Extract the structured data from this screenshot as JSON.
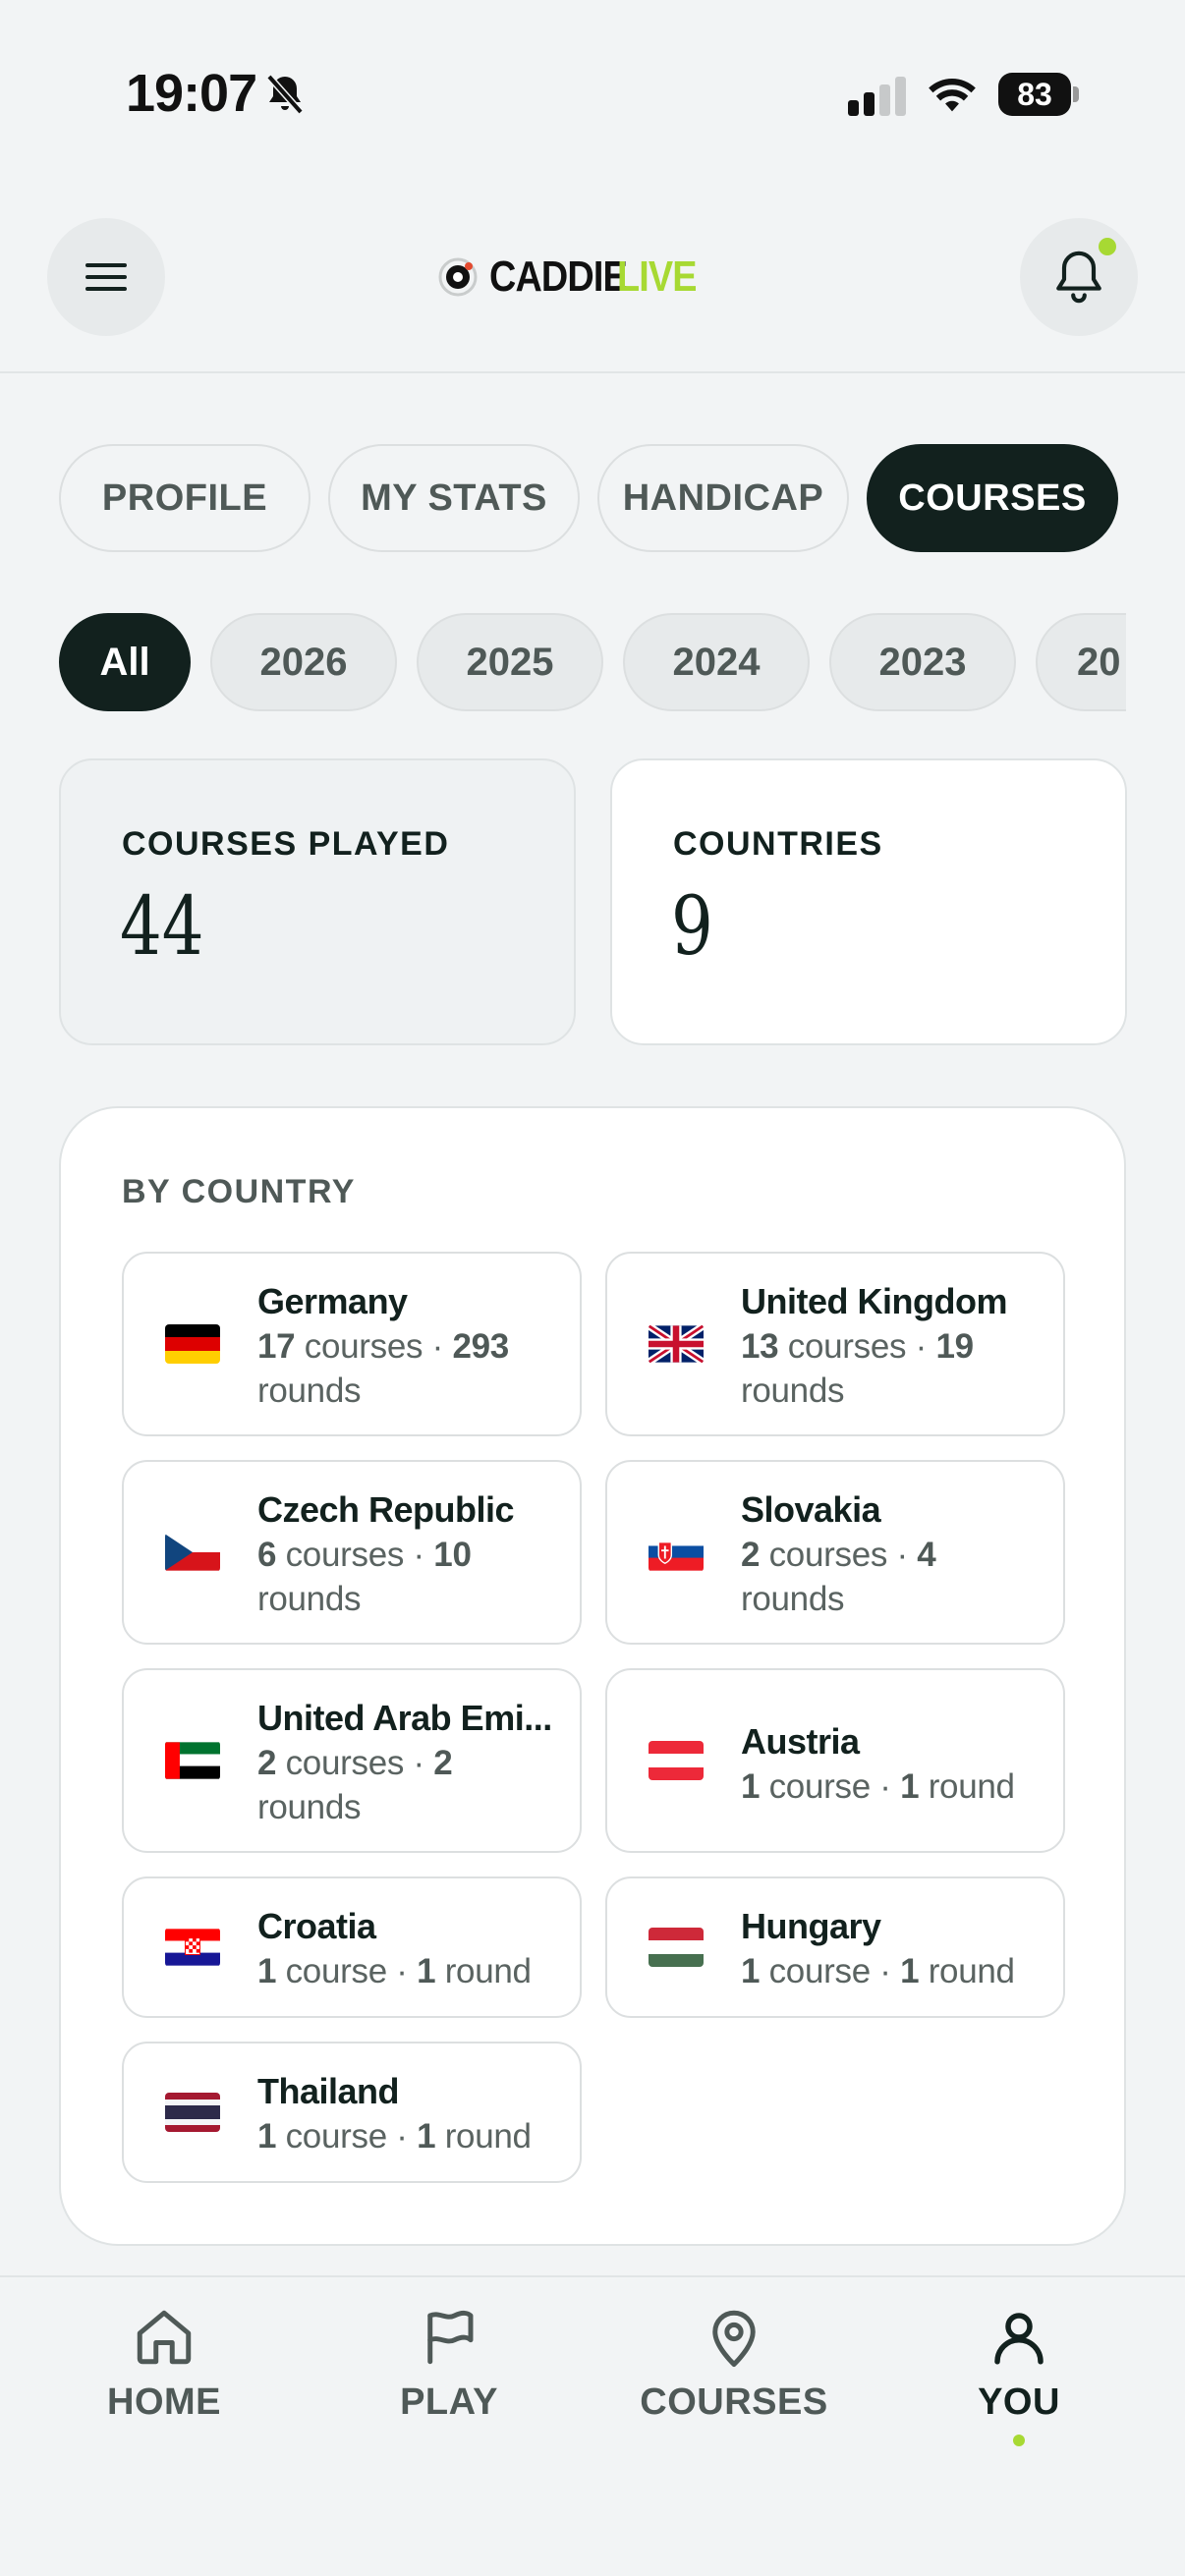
{
  "status_bar": {
    "time": "19:07",
    "battery": "83"
  },
  "header": {
    "logo_word1": "CADDIE",
    "logo_word2": "LIVE",
    "menu_icon": "hamburger-menu-icon",
    "bell_icon": "bell-icon"
  },
  "tabs": [
    {
      "label": "PROFILE",
      "active": false
    },
    {
      "label": "MY STATS",
      "active": false
    },
    {
      "label": "HANDICAP",
      "active": false
    },
    {
      "label": "COURSES",
      "active": true
    }
  ],
  "years": [
    {
      "label": "All",
      "active": true
    },
    {
      "label": "2026",
      "active": false
    },
    {
      "label": "2025",
      "active": false
    },
    {
      "label": "2024",
      "active": false
    },
    {
      "label": "2023",
      "active": false
    },
    {
      "label": "20",
      "active": false
    }
  ],
  "stats": {
    "courses_played_label": "COURSES PLAYED",
    "courses_played_value": "44",
    "countries_label": "COUNTRIES",
    "countries_value": "9"
  },
  "by_country": {
    "title": "BY COUNTRY",
    "countries": [
      {
        "name": "Germany",
        "courses": "17",
        "courses_word": "courses",
        "rounds": "293",
        "rounds_word": "rounds",
        "flag": "germany-flag"
      },
      {
        "name": "United Kingdom",
        "courses": "13",
        "courses_word": "courses",
        "rounds": "19",
        "rounds_word": "rounds",
        "flag": "uk-flag"
      },
      {
        "name": "Czech Republic",
        "courses": "6",
        "courses_word": "courses",
        "rounds": "10",
        "rounds_word": "rounds",
        "flag": "czech-flag"
      },
      {
        "name": "Slovakia",
        "courses": "2",
        "courses_word": "courses",
        "rounds": "4",
        "rounds_word": "rounds",
        "flag": "slovakia-flag"
      },
      {
        "name": "United Arab Emi...",
        "courses": "2",
        "courses_word": "courses",
        "rounds": "2",
        "rounds_word": "rounds",
        "flag": "uae-flag"
      },
      {
        "name": "Austria",
        "courses": "1",
        "courses_word": "course",
        "rounds": "1",
        "rounds_word": "round",
        "flag": "austria-flag"
      },
      {
        "name": "Croatia",
        "courses": "1",
        "courses_word": "course",
        "rounds": "1",
        "rounds_word": "round",
        "flag": "croatia-flag"
      },
      {
        "name": "Hungary",
        "courses": "1",
        "courses_word": "course",
        "rounds": "1",
        "rounds_word": "round",
        "flag": "hungary-flag"
      },
      {
        "name": "Thailand",
        "courses": "1",
        "courses_word": "course",
        "rounds": "1",
        "rounds_word": "round",
        "flag": "thailand-flag"
      }
    ]
  },
  "bottom_nav": [
    {
      "label": "HOME",
      "icon": "home-icon",
      "active": false
    },
    {
      "label": "PLAY",
      "icon": "flag-icon",
      "active": false
    },
    {
      "label": "COURSES",
      "icon": "map-pin-icon",
      "active": false
    },
    {
      "label": "YOU",
      "icon": "user-icon",
      "active": true
    }
  ],
  "colors": {
    "accent": "#a7d933",
    "dark": "#12211e",
    "background": "#f2f4f5"
  }
}
